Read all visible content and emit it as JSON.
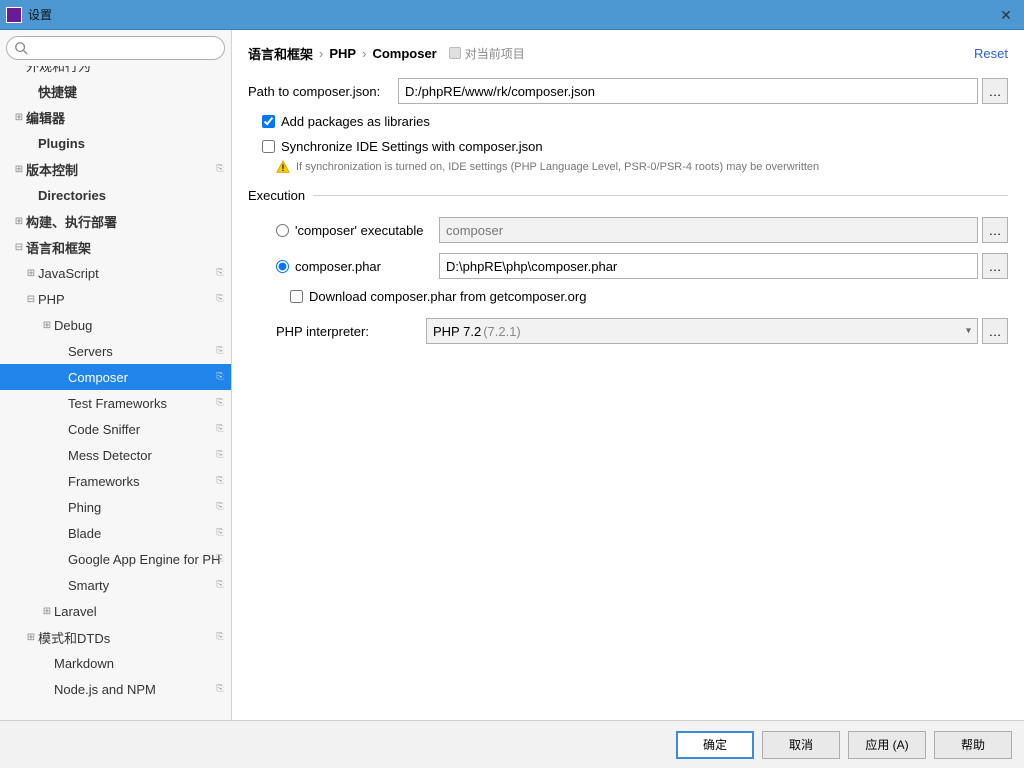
{
  "window": {
    "title": "设置"
  },
  "sidebar": {
    "search_placeholder": "",
    "items": [
      {
        "label": "外观和行为",
        "indent": 0,
        "exp": "",
        "bold": false,
        "badge": "",
        "cut": true
      },
      {
        "label": "快捷键",
        "indent": 1,
        "exp": "",
        "bold": true,
        "badge": ""
      },
      {
        "label": "编辑器",
        "indent": 0,
        "exp": "⊞",
        "bold": true,
        "badge": ""
      },
      {
        "label": "Plugins",
        "indent": 1,
        "exp": "",
        "bold": true,
        "badge": ""
      },
      {
        "label": "版本控制",
        "indent": 0,
        "exp": "⊞",
        "bold": true,
        "badge": "⎘"
      },
      {
        "label": "Directories",
        "indent": 1,
        "exp": "",
        "bold": true,
        "badge": ""
      },
      {
        "label": "构建、执行部署",
        "indent": 0,
        "exp": "⊞",
        "bold": true,
        "badge": ""
      },
      {
        "label": "语言和框架",
        "indent": 0,
        "exp": "⊟",
        "bold": true,
        "badge": ""
      },
      {
        "label": "JavaScript",
        "indent": 1,
        "exp": "⊞",
        "bold": false,
        "badge": "⎘"
      },
      {
        "label": "PHP",
        "indent": 1,
        "exp": "⊟",
        "bold": false,
        "badge": "⎘"
      },
      {
        "label": "Debug",
        "indent": 2,
        "exp": "⊞",
        "bold": false,
        "badge": ""
      },
      {
        "label": "Servers",
        "indent": 3,
        "exp": "",
        "bold": false,
        "badge": "⎘"
      },
      {
        "label": "Composer",
        "indent": 3,
        "exp": "",
        "bold": false,
        "badge": "⎘",
        "selected": true
      },
      {
        "label": "Test Frameworks",
        "indent": 3,
        "exp": "",
        "bold": false,
        "badge": "⎘"
      },
      {
        "label": "Code Sniffer",
        "indent": 3,
        "exp": "",
        "bold": false,
        "badge": "⎘"
      },
      {
        "label": "Mess Detector",
        "indent": 3,
        "exp": "",
        "bold": false,
        "badge": "⎘"
      },
      {
        "label": "Frameworks",
        "indent": 3,
        "exp": "",
        "bold": false,
        "badge": "⎘"
      },
      {
        "label": "Phing",
        "indent": 3,
        "exp": "",
        "bold": false,
        "badge": "⎘"
      },
      {
        "label": "Blade",
        "indent": 3,
        "exp": "",
        "bold": false,
        "badge": "⎘"
      },
      {
        "label": "Google App Engine for PH",
        "indent": 3,
        "exp": "",
        "bold": false,
        "badge": "⎘"
      },
      {
        "label": "Smarty",
        "indent": 3,
        "exp": "",
        "bold": false,
        "badge": "⎘"
      },
      {
        "label": "Laravel",
        "indent": 2,
        "exp": "⊞",
        "bold": false,
        "badge": ""
      },
      {
        "label": "模式和DTDs",
        "indent": 1,
        "exp": "⊞",
        "bold": false,
        "badge": "⎘"
      },
      {
        "label": "Markdown",
        "indent": 2,
        "exp": "",
        "bold": false,
        "badge": ""
      },
      {
        "label": "Node.js and NPM",
        "indent": 2,
        "exp": "",
        "bold": false,
        "badge": "⎘"
      }
    ]
  },
  "header": {
    "crumb1": "语言和框架",
    "crumb2": "PHP",
    "crumb3": "Composer",
    "scope": "对当前项目",
    "reset": "Reset"
  },
  "form": {
    "path_label": "Path to composer.json:",
    "path_value": "D:/phpRE/www/rk/composer.json",
    "cb_add": "Add packages as libraries",
    "cb_sync": "Synchronize IDE Settings with composer.json",
    "warn_text": "If synchronization is turned on, IDE settings (PHP Language Level, PSR-0/PSR-4 roots) may be overwritten",
    "section_exec": "Execution",
    "radio_exec_label": "'composer' executable",
    "exec_placeholder": "composer",
    "radio_phar_label": "composer.phar",
    "phar_value": "D:\\phpRE\\php\\composer.phar",
    "cb_download": "Download composer.phar from getcomposer.org",
    "interp_label": "PHP interpreter:",
    "interp_name": "PHP 7.2",
    "interp_ver": "(7.2.1)"
  },
  "footer": {
    "ok": "确定",
    "cancel": "取消",
    "apply": "应用 (A)",
    "help": "帮助"
  }
}
